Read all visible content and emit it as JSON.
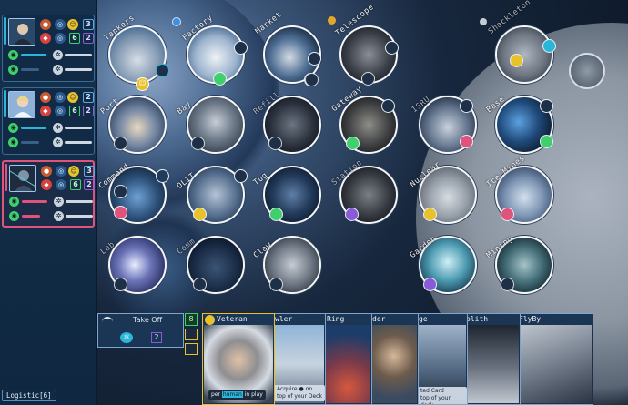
{
  "players": [
    {
      "id": "p1",
      "accent": "#29b6d8",
      "counts": [
        "3",
        "2",
        "6",
        "2"
      ],
      "active": false
    },
    {
      "id": "p2",
      "accent": "#29b6d8",
      "counts": [
        "2",
        "3",
        "6",
        "2"
      ],
      "active": false
    },
    {
      "id": "p3",
      "accent": "#e0537a",
      "counts": [
        "3",
        "2",
        "6",
        "2"
      ],
      "active": true
    }
  ],
  "logistic_label": "Logistic[6]",
  "locations": [
    {
      "key": "tankers",
      "label": "Tankers"
    },
    {
      "key": "factory",
      "label": "Factory"
    },
    {
      "key": "market",
      "label": "Market"
    },
    {
      "key": "telescope",
      "label": "Telescope"
    },
    {
      "key": "shackleton",
      "label": "Shackleton"
    },
    {
      "key": "port",
      "label": "Port"
    },
    {
      "key": "bay",
      "label": "Bay"
    },
    {
      "key": "refill",
      "label": "Refill"
    },
    {
      "key": "gateway",
      "label": "Gateway"
    },
    {
      "key": "isru",
      "label": "ISRU"
    },
    {
      "key": "base",
      "label": "Base"
    },
    {
      "key": "command",
      "label": "Command"
    },
    {
      "key": "olit",
      "label": "OLIT"
    },
    {
      "key": "tug",
      "label": "Tug"
    },
    {
      "key": "station",
      "label": "Station"
    },
    {
      "key": "nuclear",
      "label": "Nuclear"
    },
    {
      "key": "icemines",
      "label": "Ice Mines"
    },
    {
      "key": "lab",
      "label": "Lab"
    },
    {
      "key": "comm",
      "label": "Comm"
    },
    {
      "key": "claw",
      "label": "Claw"
    },
    {
      "key": "garden",
      "label": "Garden"
    },
    {
      "key": "mining",
      "label": "Mining"
    }
  ],
  "hand": {
    "takeoff_label": "Take Off",
    "takeoff_value": "2",
    "takeoff_count": "8",
    "cards": [
      {
        "key": "veteran",
        "title": "Veteran",
        "text_a": "per",
        "text_b": "human",
        "text_c": "in play"
      },
      {
        "key": "crawler",
        "title": "wler",
        "text_a": "Acquire",
        "text_b": "on",
        "text_c": "top of your Deck"
      },
      {
        "key": "ring",
        "title": "Ring"
      },
      {
        "key": "leader",
        "title": "der"
      },
      {
        "key": "image",
        "title": "ge",
        "text_a": "ted Card",
        "text_c": "top of your deck."
      },
      {
        "key": "monolith",
        "title": "olith"
      },
      {
        "key": "flyby",
        "title": "FlyBy"
      }
    ]
  },
  "colors": {
    "cyan": "#29b6d8",
    "pink": "#e0537a",
    "gold": "#e8c22b",
    "green": "#3fcf6b",
    "purple": "#8a5ad8",
    "red": "#d8423c"
  }
}
